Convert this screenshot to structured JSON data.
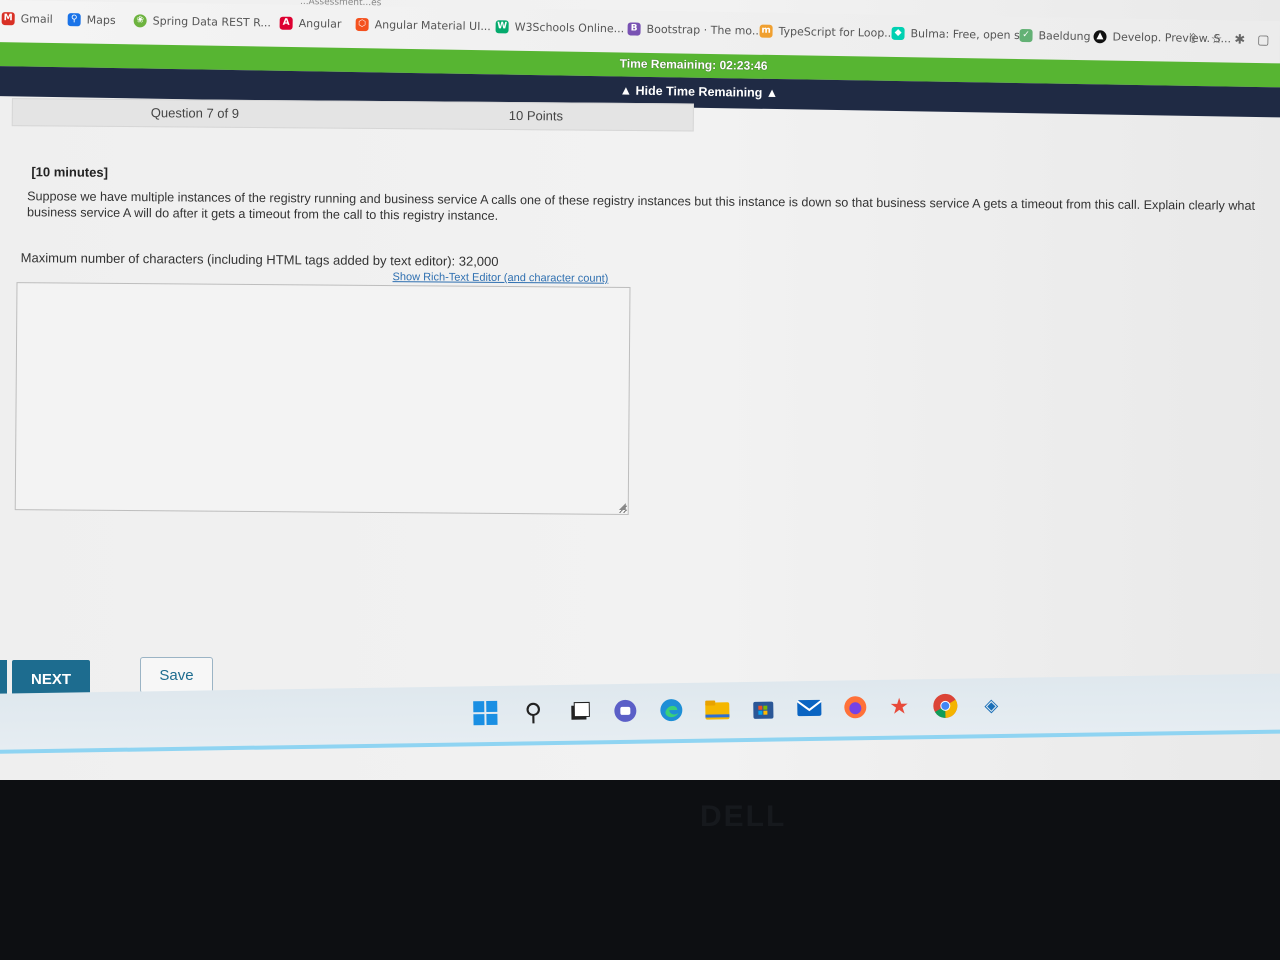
{
  "browser": {
    "url_fragment": "...Assessment...es",
    "bookmarks": [
      {
        "label": "Gmail",
        "icon": "gmail-icon",
        "color": "#d93025"
      },
      {
        "label": "Maps",
        "icon": "maps-icon",
        "color": "#1a73e8"
      },
      {
        "label": "Spring Data REST R...",
        "icon": "spring-icon",
        "color": "#6db33f"
      },
      {
        "label": "Angular",
        "icon": "angular-icon",
        "color": "#dd0031"
      },
      {
        "label": "Angular Material UI...",
        "icon": "angular-material-icon",
        "color": "#f4511e"
      },
      {
        "label": "W3Schools Online...",
        "icon": "w3schools-icon",
        "color": "#04aa6d"
      },
      {
        "label": "Bootstrap · The mo...",
        "icon": "bootstrap-icon",
        "color": "#7952b3"
      },
      {
        "label": "TypeScript for Loop...",
        "icon": "typescript-icon",
        "color": "#f0a030"
      },
      {
        "label": "Bulma: Free, open s...",
        "icon": "bulma-icon",
        "color": "#00d1b2"
      },
      {
        "label": "Baeldung",
        "icon": "baeldung-icon",
        "color": "#63b175"
      },
      {
        "label": "Develop. Preview. S...",
        "icon": "vercel-icon",
        "color": "#111111"
      }
    ]
  },
  "timer": {
    "remaining_text": "Time Remaining: 02:23:46",
    "toggle_label": "▲ Hide Time Remaining ▲"
  },
  "question": {
    "counter": "Question 7 of 9",
    "points": "10 Points",
    "duration": "[10 minutes]",
    "text": "Suppose we have multiple instances of the registry running and business service A calls one of these registry instances but this instance is down so that business service A gets a timeout from this call. Explain clearly what business service A will do after it gets a timeout from the call to this registry instance.",
    "max_chars": "Maximum number of characters (including HTML tags added by text editor): 32,000",
    "rte_link": "Show Rich-Text Editor (and character count)",
    "answer_value": ""
  },
  "actions": {
    "next_label": "NEXT",
    "save_label": "Save"
  },
  "taskbar": {
    "icons": [
      "windows-start-icon",
      "search-icon",
      "task-view-icon",
      "chat-icon",
      "edge-icon",
      "file-explorer-icon",
      "store-icon",
      "mail-icon",
      "firefox-icon",
      "star-app-icon",
      "chrome-icon",
      "vpn-icon"
    ],
    "accent": "#1a8fe3"
  },
  "monitor_brand": "DELL"
}
